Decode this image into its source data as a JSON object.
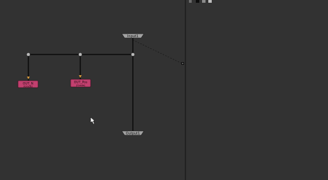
{
  "graph": {
    "input_node": {
      "label": "Input1"
    },
    "output_node": {
      "label": "Output1"
    },
    "node_pink_left": {
      "label": "OUT_N",
      "sublabel": "(Grade)"
    },
    "node_pink_right": {
      "label": "OUT_Pos",
      "sublabel": "(Grade)"
    }
  },
  "colors": {
    "background": "#323232",
    "wire": "#0a0a0a",
    "node_pink": "#c2406f",
    "node_gray": "#9a9a9a",
    "divider": "#1e1e1e"
  },
  "toolbar_icons": [
    "tool-icon-1",
    "tool-icon-2",
    "tool-icon-3",
    "tool-icon-4"
  ]
}
